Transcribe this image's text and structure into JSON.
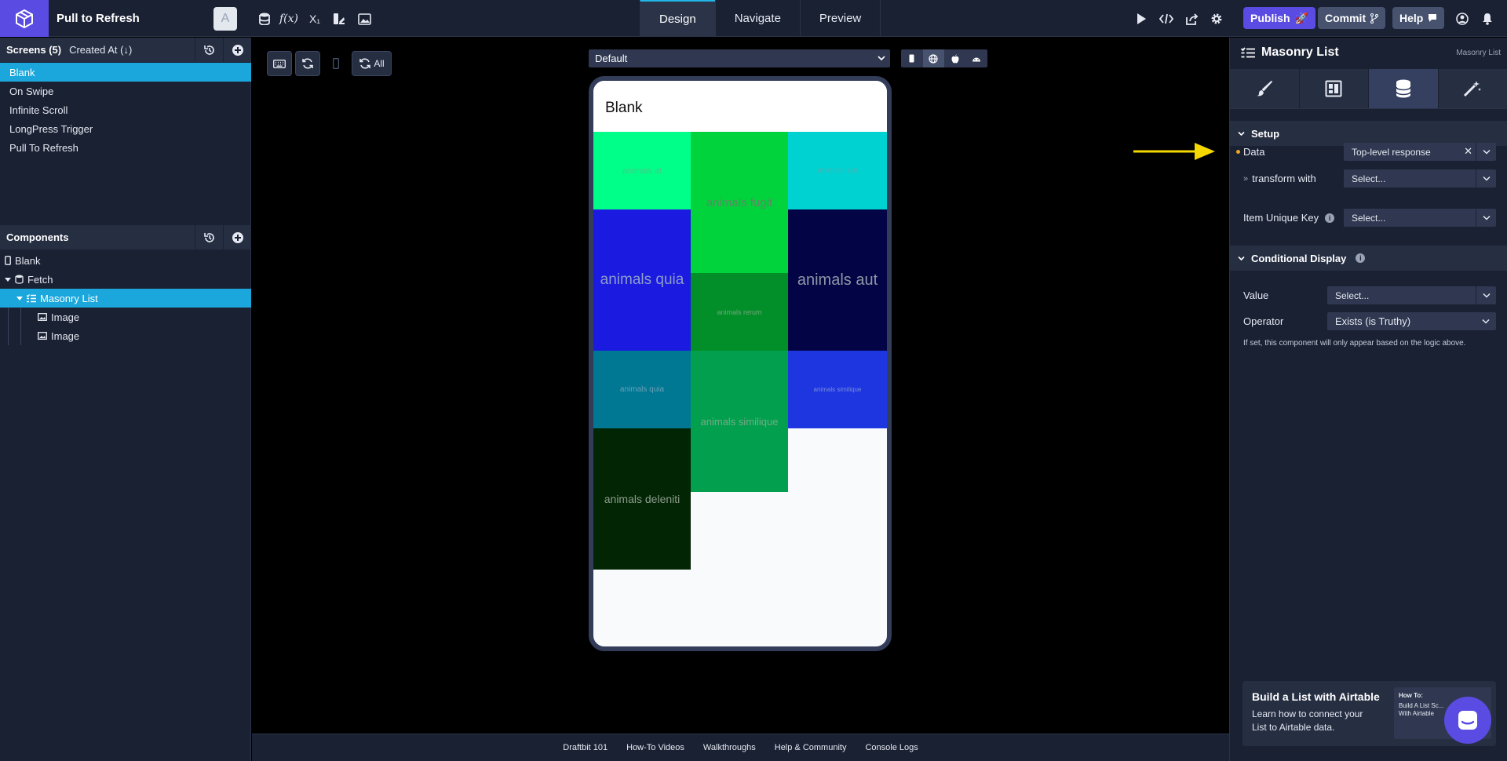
{
  "app": {
    "project_name": "Pull to Refresh",
    "avatar_letter": "A"
  },
  "toolbar": {
    "icons": [
      "database-icon",
      "function-icon",
      "subscript-icon",
      "assets-icon",
      "image-icon"
    ]
  },
  "tabs": [
    {
      "label": "Design",
      "active": true
    },
    {
      "label": "Navigate",
      "active": false
    },
    {
      "label": "Preview",
      "active": false
    }
  ],
  "actions": {
    "publish": "Publish",
    "commit": "Commit",
    "help": "Help"
  },
  "screens": {
    "title": "Screens (5)",
    "sort": "Created At (↓)",
    "items": [
      "Blank",
      "On Swipe",
      "Infinite Scroll",
      "LongPress Trigger",
      "Pull To Refresh"
    ],
    "selected": "Blank"
  },
  "components": {
    "title": "Components",
    "tree": [
      {
        "label": "Blank",
        "icon": "phone-icon",
        "depth": 0
      },
      {
        "label": "Fetch",
        "icon": "database-icon",
        "depth": 0,
        "expanded": true
      },
      {
        "label": "Masonry List",
        "icon": "list-icon",
        "depth": 1,
        "expanded": true,
        "selected": true
      },
      {
        "label": "Image",
        "icon": "image-icon",
        "depth": 2
      },
      {
        "label": "Image",
        "icon": "image-icon",
        "depth": 2
      }
    ]
  },
  "canvas": {
    "all_label": "All",
    "device": "Default",
    "platforms": [
      "mobile-icon",
      "web-icon",
      "apple-icon",
      "android-icon"
    ],
    "selected_platform": "web-icon"
  },
  "phone": {
    "screen_title": "Blank",
    "tiles": [
      {
        "text": "animals at",
        "color": "#00ff88",
        "text_color": "#3ad089"
      },
      {
        "text": "animals fugit",
        "color": "#00d33b",
        "text_color": "#5d8a63"
      },
      {
        "text": "animals aut",
        "color": "#00d1d1",
        "text_color": "#41b8b8"
      },
      {
        "text": "animals quia",
        "color": "#1a1ae0",
        "text_color": "#8f9ec9"
      },
      {
        "text": "animals rerum",
        "color": "#028e28",
        "text_color": "#73a87d"
      },
      {
        "text": "animals aut",
        "color": "#020445",
        "text_color": "#8f97a6"
      },
      {
        "text": "animals quia",
        "color": "#007793",
        "text_color": "#69a0b5"
      },
      {
        "text": "animals similique",
        "color": "#02a04e",
        "text_color": "#78a887"
      },
      {
        "text": "animals similique",
        "color": "#1d36e0",
        "text_color": "#7b8bd8"
      },
      {
        "text": "animals deleniti",
        "color": "#022503",
        "text_color": "#8e9b8f"
      }
    ]
  },
  "footer": {
    "links": [
      "Draftbit 101",
      "How-To Videos",
      "Walkthroughs",
      "Help & Community",
      "Console Logs"
    ]
  },
  "inspector": {
    "title": "Masonry List",
    "subtitle": "Masonry List",
    "tabs": [
      "brush-icon",
      "layout-icon",
      "data-icon",
      "magic-icon"
    ],
    "active_tab": "data-icon",
    "setup": {
      "heading": "Setup",
      "data_label": "Data",
      "data_value": "Top-level response",
      "transform_label": "transform with",
      "transform_value": "Select...",
      "key_label": "Item Unique Key",
      "key_value": "Select..."
    },
    "conditional": {
      "heading": "Conditional Display",
      "value_label": "Value",
      "value_value": "Select...",
      "operator_label": "Operator",
      "operator_value": "Exists (is Truthy)",
      "note": "If set, this component will only appear based on the logic above."
    },
    "promo": {
      "title": "Build a List with Airtable",
      "text": "Learn how to connect your List to Airtable data.",
      "thumb_title": "How To:",
      "thumb_text": "Build A List Sc... With Airtable"
    }
  },
  "colors": {
    "accent": "#1ba7dc",
    "brand": "#5a4be3",
    "annotation": "#f5d800"
  }
}
